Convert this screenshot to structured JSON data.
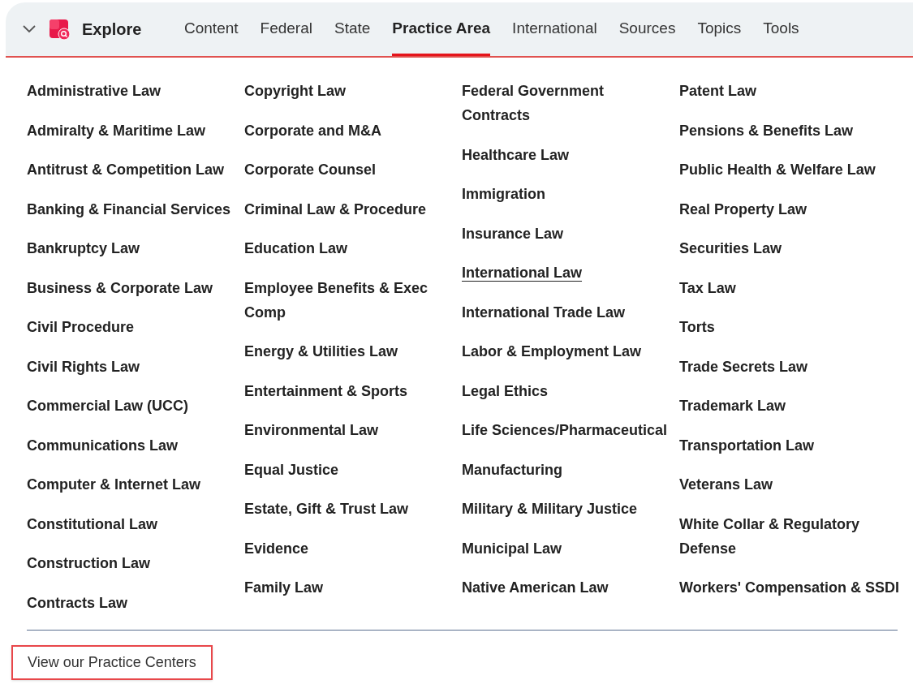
{
  "header": {
    "title": "Explore",
    "tabs": [
      {
        "label": "Content",
        "selected": false
      },
      {
        "label": "Federal",
        "selected": false
      },
      {
        "label": "State",
        "selected": false
      },
      {
        "label": "Practice Area",
        "selected": true
      },
      {
        "label": "International",
        "selected": false
      },
      {
        "label": "Sources",
        "selected": false
      },
      {
        "label": "Topics",
        "selected": false
      },
      {
        "label": "Tools",
        "selected": false
      }
    ]
  },
  "columns": [
    [
      {
        "label": "Administrative Law",
        "underlined": false
      },
      {
        "label": "Admiralty & Maritime Law",
        "underlined": false
      },
      {
        "label": "Antitrust & Competition Law",
        "underlined": false
      },
      {
        "label": "Banking & Financial Services",
        "underlined": false
      },
      {
        "label": "Bankruptcy Law",
        "underlined": false
      },
      {
        "label": "Business & Corporate Law",
        "underlined": false
      },
      {
        "label": "Civil Procedure",
        "underlined": false
      },
      {
        "label": "Civil Rights Law",
        "underlined": false
      },
      {
        "label": "Commercial Law (UCC)",
        "underlined": false
      },
      {
        "label": "Communications Law",
        "underlined": false
      },
      {
        "label": "Computer & Internet Law",
        "underlined": false
      },
      {
        "label": "Constitutional Law",
        "underlined": false
      },
      {
        "label": "Construction Law",
        "underlined": false
      },
      {
        "label": "Contracts Law",
        "underlined": false
      }
    ],
    [
      {
        "label": "Copyright Law",
        "underlined": false
      },
      {
        "label": "Corporate and M&A",
        "underlined": false
      },
      {
        "label": "Corporate Counsel",
        "underlined": false
      },
      {
        "label": "Criminal Law & Procedure",
        "underlined": false
      },
      {
        "label": "Education Law",
        "underlined": false
      },
      {
        "label": "Employee Benefits & Exec Comp",
        "underlined": false
      },
      {
        "label": "Energy & Utilities Law",
        "underlined": false
      },
      {
        "label": "Entertainment & Sports",
        "underlined": false
      },
      {
        "label": "Environmental Law",
        "underlined": false
      },
      {
        "label": "Equal Justice",
        "underlined": false
      },
      {
        "label": "Estate, Gift & Trust Law",
        "underlined": false
      },
      {
        "label": "Evidence",
        "underlined": false
      },
      {
        "label": "Family Law",
        "underlined": false
      }
    ],
    [
      {
        "label": "Federal Government Contracts",
        "underlined": false
      },
      {
        "label": "Healthcare Law",
        "underlined": false
      },
      {
        "label": "Immigration",
        "underlined": false
      },
      {
        "label": "Insurance Law",
        "underlined": false
      },
      {
        "label": "International Law",
        "underlined": true
      },
      {
        "label": "International Trade Law",
        "underlined": false
      },
      {
        "label": "Labor & Employment Law",
        "underlined": false
      },
      {
        "label": "Legal Ethics",
        "underlined": false
      },
      {
        "label": "Life Sciences/Pharmaceutical",
        "underlined": false
      },
      {
        "label": "Manufacturing",
        "underlined": false
      },
      {
        "label": "Military & Military Justice",
        "underlined": false
      },
      {
        "label": "Municipal Law",
        "underlined": false
      },
      {
        "label": "Native American Law",
        "underlined": false
      }
    ],
    [
      {
        "label": "Patent Law",
        "underlined": false
      },
      {
        "label": "Pensions & Benefits Law",
        "underlined": false
      },
      {
        "label": "Public Health & Welfare Law",
        "underlined": false
      },
      {
        "label": "Real Property Law",
        "underlined": false
      },
      {
        "label": "Securities Law",
        "underlined": false
      },
      {
        "label": "Tax Law",
        "underlined": false
      },
      {
        "label": "Torts",
        "underlined": false
      },
      {
        "label": "Trade Secrets Law",
        "underlined": false
      },
      {
        "label": "Trademark Law",
        "underlined": false
      },
      {
        "label": "Transportation Law",
        "underlined": false
      },
      {
        "label": "Veterans Law",
        "underlined": false
      },
      {
        "label": "White Collar & Regulatory Defense",
        "underlined": false
      },
      {
        "label": "Workers' Compensation & SSDI",
        "underlined": false
      }
    ]
  ],
  "footer_link": "View our Practice Centers"
}
